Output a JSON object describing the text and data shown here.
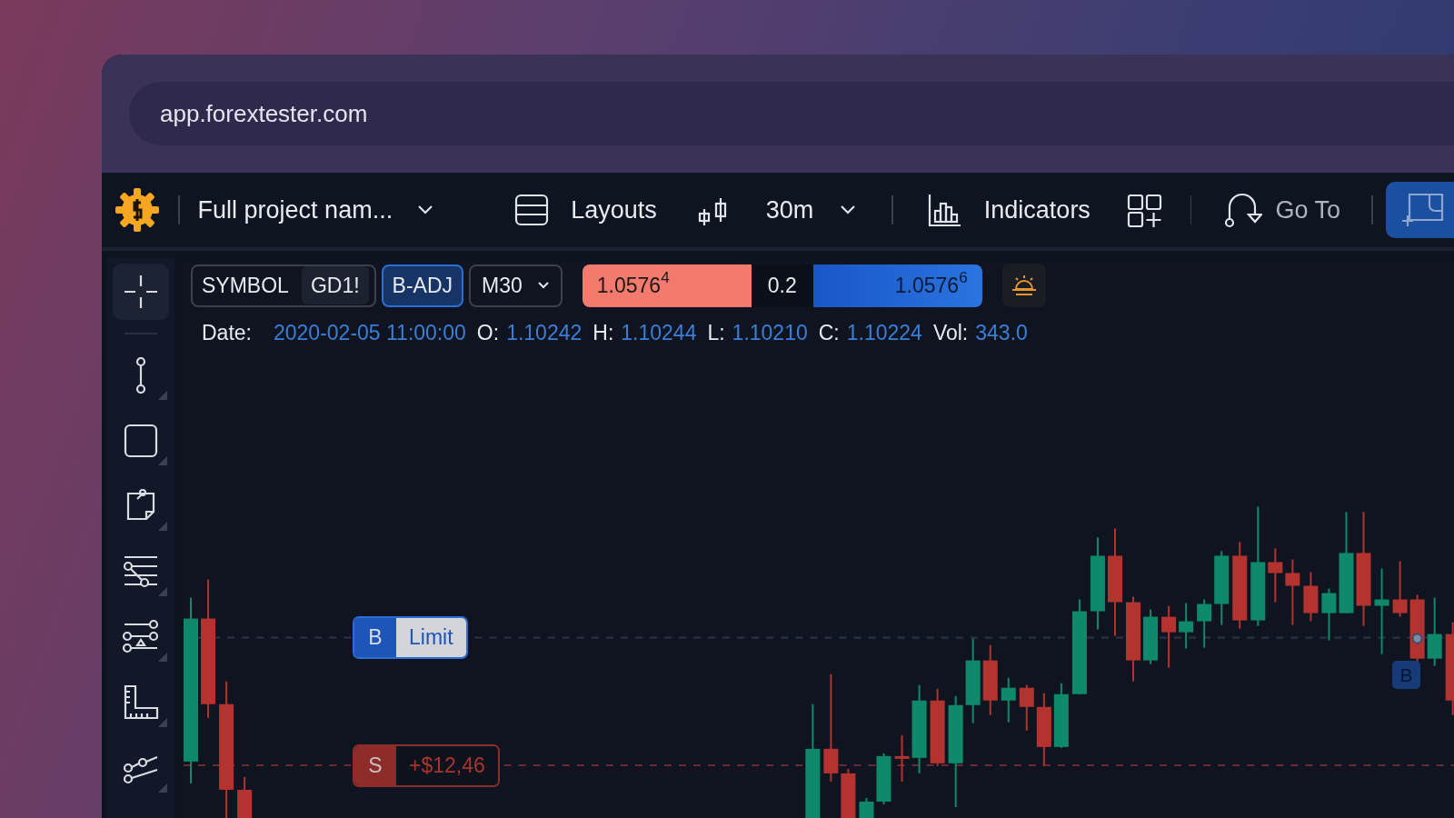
{
  "browser": {
    "url": "app.forextester.com"
  },
  "toolbar": {
    "project_name": "Full project nam...",
    "layouts_label": "Layouts",
    "timeframe": "30m",
    "indicators_label": "Indicators",
    "goto_label": "Go To"
  },
  "symbol_bar": {
    "symbol_label": "SYMBOL",
    "symbol": "GD1!",
    "adjust": {
      "label": "B-ADJ",
      "selected": true
    },
    "period": "M30",
    "bid": "1.0576$^{4}$",
    "spread": "0.2",
    "ask": "1.0576$^{6}$"
  },
  "ohlc": [
    {
      "label": "Date:",
      "value": "2020-02-05 11:00:00"
    },
    {
      "label": "O:",
      "value": "1.10242"
    },
    {
      "label": "H:",
      "value": "1.10244"
    },
    {
      "label": "L:",
      "value": "1.10210"
    },
    {
      "label": "C:",
      "value": "1.10224"
    },
    {
      "label": "Vol:",
      "value": "343.0"
    }
  ],
  "tools": [
    {
      "kind": "crosshair",
      "selected": true
    },
    {
      "kind": "line",
      "selected": false
    },
    {
      "kind": "rectangle",
      "selected": false
    },
    {
      "kind": "note",
      "selected": false
    },
    {
      "kind": "fib",
      "selected": false
    },
    {
      "kind": "pattern",
      "selected": false
    },
    {
      "kind": "ruler",
      "selected": false
    },
    {
      "kind": "fan",
      "selected": false
    }
  ],
  "orders": [
    {
      "kind": "limit",
      "side": "B",
      "label": "Limit"
    },
    {
      "kind": "profit",
      "side": "S",
      "label": "+$12,46"
    }
  ],
  "chart_marker": "B"
}
